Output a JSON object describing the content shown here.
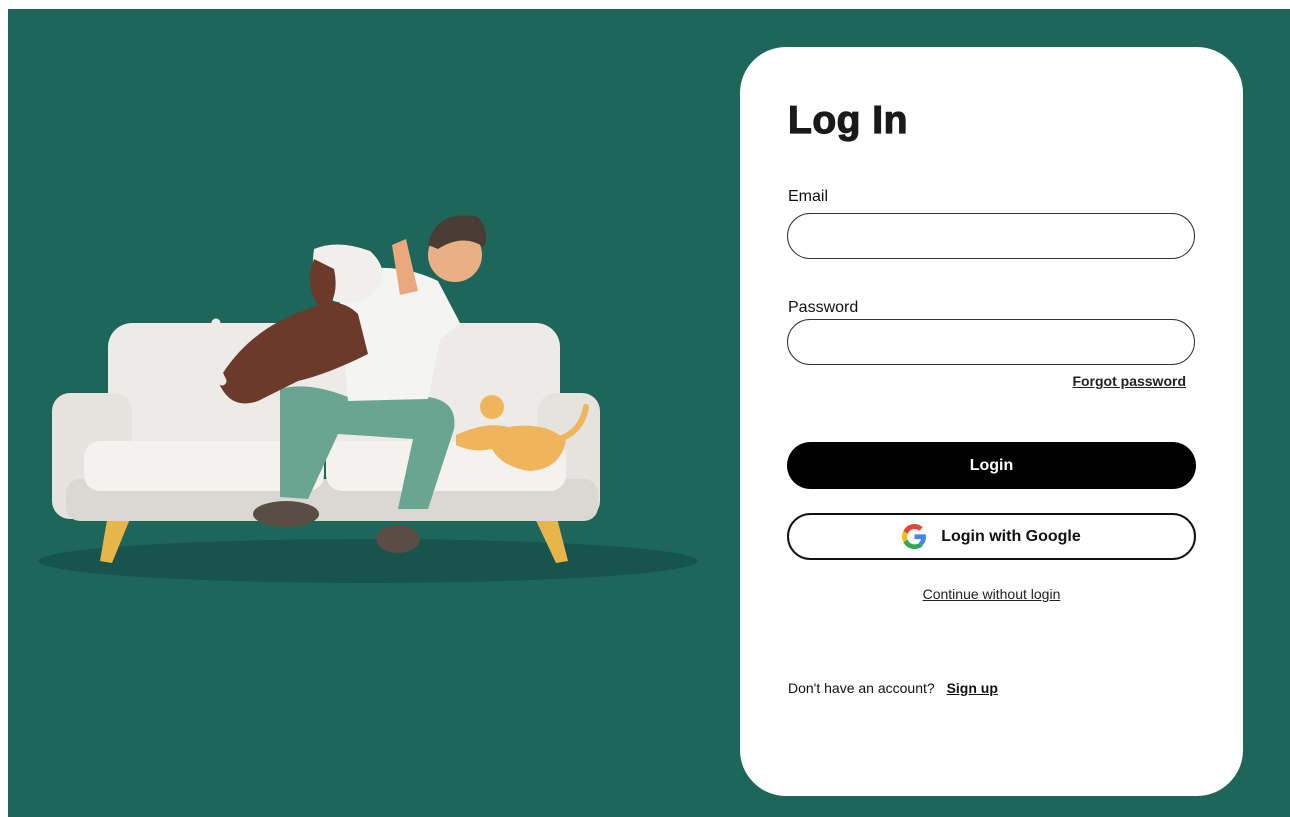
{
  "colors": {
    "background": "#1e6659",
    "card": "#ffffff",
    "primary_button": "#000000",
    "text": "#111111"
  },
  "illustration": {
    "icon": "man-with-dog-and-cat-on-sofa-illustration"
  },
  "login_form": {
    "title": "Log In",
    "email": {
      "label": "Email",
      "value": "",
      "placeholder": ""
    },
    "password": {
      "label": "Password",
      "value": "",
      "placeholder": ""
    },
    "forgot_password": "Forgot password",
    "login_button": "Login",
    "google_button": {
      "label": "Login with Google",
      "icon": "google-g-icon"
    },
    "continue_without_login": "Continue without login",
    "signup_prompt": "Don't have an account?",
    "signup_link": "Sign up"
  }
}
